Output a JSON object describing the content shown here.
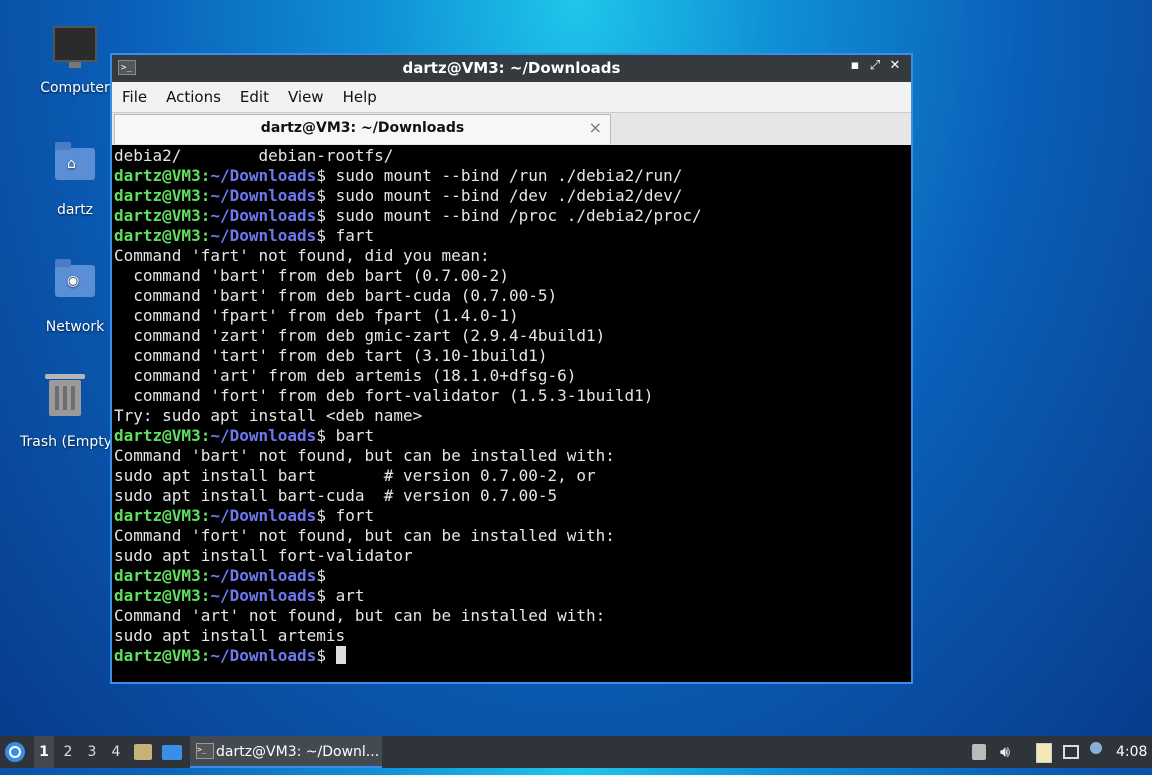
{
  "desktop": {
    "icons": [
      {
        "label": "Computer",
        "icon": "computer-icon"
      },
      {
        "label": "dartz",
        "icon": "home-folder-icon"
      },
      {
        "label": "Network",
        "icon": "network-folder-icon"
      },
      {
        "label": "Trash (Empty)",
        "icon": "trash-icon"
      }
    ]
  },
  "window": {
    "title": "dartz@VM3: ~/Downloads",
    "controls": {
      "minimize": "▪",
      "maximize": "⤢",
      "close": "✕"
    },
    "menu": [
      "File",
      "Actions",
      "Edit",
      "View",
      "Help"
    ],
    "tab": {
      "label": "dartz@VM3: ~/Downloads",
      "close": "×"
    }
  },
  "terminal": {
    "prompt_user": "dartz@VM3",
    "prompt_path": "~/Downloads",
    "lines": [
      {
        "type": "out",
        "text": "debia2/        debian-rootfs/"
      },
      {
        "type": "cmd",
        "text": " sudo mount --bind /run ./debia2/run/"
      },
      {
        "type": "cmd",
        "text": " sudo mount --bind /dev ./debia2/dev/"
      },
      {
        "type": "cmd",
        "text": " sudo mount --bind /proc ./debia2/proc/"
      },
      {
        "type": "cmd",
        "text": " fart"
      },
      {
        "type": "out",
        "text": "Command 'fart' not found, did you mean:"
      },
      {
        "type": "out",
        "text": "  command 'bart' from deb bart (0.7.00-2)"
      },
      {
        "type": "out",
        "text": "  command 'bart' from deb bart-cuda (0.7.00-5)"
      },
      {
        "type": "out",
        "text": "  command 'fpart' from deb fpart (1.4.0-1)"
      },
      {
        "type": "out",
        "text": "  command 'zart' from deb gmic-zart (2.9.4-4build1)"
      },
      {
        "type": "out",
        "text": "  command 'tart' from deb tart (3.10-1build1)"
      },
      {
        "type": "out",
        "text": "  command 'art' from deb artemis (18.1.0+dfsg-6)"
      },
      {
        "type": "out",
        "text": "  command 'fort' from deb fort-validator (1.5.3-1build1)"
      },
      {
        "type": "out",
        "text": "Try: sudo apt install <deb name>"
      },
      {
        "type": "cmd",
        "text": " bart"
      },
      {
        "type": "out",
        "text": "Command 'bart' not found, but can be installed with:"
      },
      {
        "type": "out",
        "text": "sudo apt install bart       # version 0.7.00-2, or"
      },
      {
        "type": "out",
        "text": "sudo apt install bart-cuda  # version 0.7.00-5"
      },
      {
        "type": "cmd",
        "text": " fort"
      },
      {
        "type": "out",
        "text": "Command 'fort' not found, but can be installed with:"
      },
      {
        "type": "out",
        "text": "sudo apt install fort-validator"
      },
      {
        "type": "cmd",
        "text": ""
      },
      {
        "type": "cmd",
        "text": " art"
      },
      {
        "type": "out",
        "text": "Command 'art' not found, but can be installed with:"
      },
      {
        "type": "out",
        "text": "sudo apt install artemis"
      },
      {
        "type": "cursor",
        "text": " "
      }
    ]
  },
  "taskbar": {
    "workspaces": [
      "1",
      "2",
      "3",
      "4"
    ],
    "active_workspace": "1",
    "task_label": "dartz@VM3: ~/Downl...",
    "clock": "4:08",
    "tray_icons": [
      "keyboard-icon",
      "volume-icon",
      "clipboard-icon",
      "network-icon",
      "notification-icon"
    ]
  },
  "colors": {
    "prompt_user": "#5fe05f",
    "prompt_path": "#6d79f0",
    "accent": "#3a8ee6"
  }
}
